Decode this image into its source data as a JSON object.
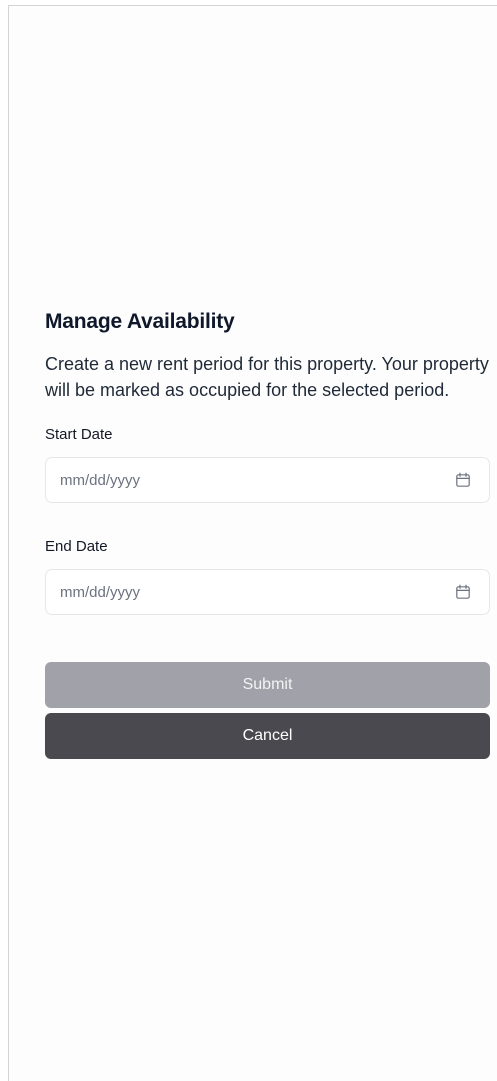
{
  "dialog": {
    "title": "Manage Availability",
    "description": "Create a new rent period for this property. Your property will be marked as occupied for the selected period."
  },
  "start_date": {
    "label": "Start Date",
    "placeholder": "mm/dd/yyyy",
    "value": "",
    "icon": "calendar-icon"
  },
  "end_date": {
    "label": "End Date",
    "placeholder": "mm/dd/yyyy",
    "value": "",
    "icon": "calendar-icon"
  },
  "actions": {
    "submit_label": "Submit",
    "cancel_label": "Cancel",
    "submit_disabled": true
  },
  "colors": {
    "submit_bg": "#a1a1aa",
    "cancel_bg": "#4a4950",
    "input_border": "#e5e7eb",
    "placeholder": "#6b7280"
  }
}
